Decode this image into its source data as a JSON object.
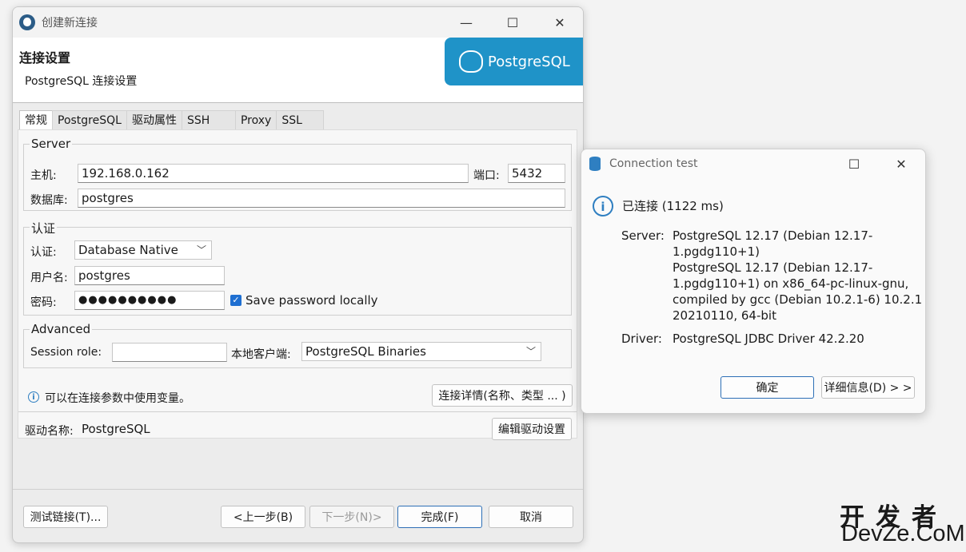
{
  "main_window": {
    "title": "创建新连接",
    "header_title": "连接设置",
    "header_subtitle": "PostgreSQL 连接设置",
    "logo_text": "PostgreSQL",
    "tabs": [
      "常规",
      "PostgreSQL",
      "驱动属性",
      "SSH",
      "Proxy",
      "SSL"
    ],
    "server": {
      "legend": "Server",
      "host_label": "主机:",
      "host_value": "192.168.0.162",
      "port_label": "端口:",
      "port_value": "5432",
      "database_label": "数据库:",
      "database_value": "postgres"
    },
    "auth": {
      "legend": "认证",
      "auth_label": "认证:",
      "auth_value": "Database Native",
      "user_label": "用户名:",
      "user_value": "postgres",
      "password_label": "密码:",
      "password_mask": "●●●●●●●●●●",
      "save_password_label": "Save password locally"
    },
    "advanced": {
      "legend": "Advanced",
      "session_role_label": "Session role:",
      "session_role_value": "",
      "local_client_label": "本地客户端:",
      "local_client_value": "PostgreSQL Binaries"
    },
    "info_text": "可以在连接参数中使用变量。",
    "connection_details_button": "连接详情(名称、类型 ... )",
    "driver_label": "驱动名称:",
    "driver_value": "PostgreSQL",
    "edit_driver_button": "编辑驱动设置",
    "footer": {
      "test_button": "测试链接(T)...",
      "back_button": "<上一步(B)",
      "next_button": "下一步(N)>",
      "finish_button": "完成(F)",
      "cancel_button": "取消"
    }
  },
  "dialog": {
    "title": "Connection test",
    "status": "已连接 (1122 ms)",
    "server_label": "Server:",
    "server_lines": [
      "PostgreSQL 12.17 (Debian 12.17-",
      "1.pgdg110+1)",
      "PostgreSQL 12.17 (Debian 12.17-",
      "1.pgdg110+1) on x86_64-pc-linux-gnu,",
      "compiled by gcc (Debian 10.2.1-6) 10.2.1",
      "20210110, 64-bit"
    ],
    "driver_label": "Driver:",
    "driver_value": "PostgreSQL JDBC Driver 42.2.20",
    "ok_button": "确定",
    "details_button": "详细信息(D) > >"
  },
  "watermark": {
    "line1": "开发者",
    "line2": "DevZe.CoM"
  }
}
